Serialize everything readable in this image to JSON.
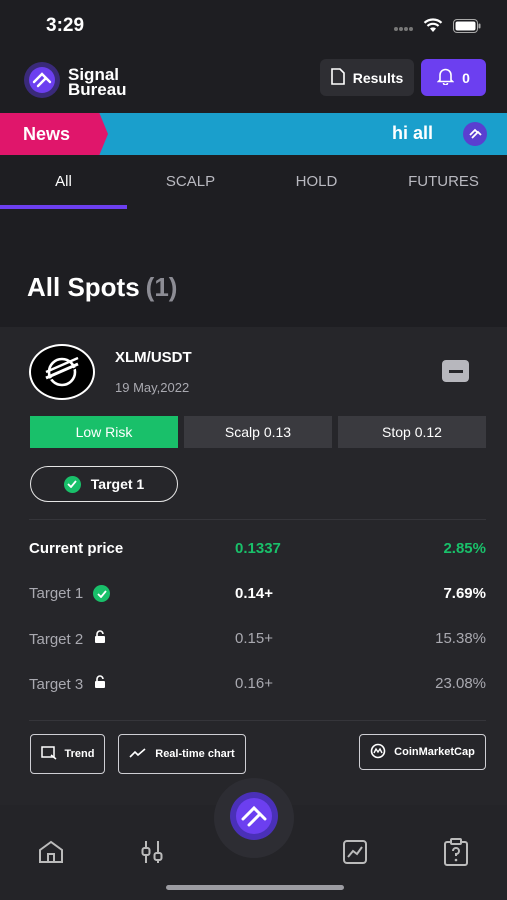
{
  "status": {
    "time": "3:29"
  },
  "header": {
    "logo_line1": "Signal",
    "logo_line2": "Bureau",
    "results_label": "Results",
    "notifications_count": "0"
  },
  "news": {
    "label": "News",
    "text": "hi all"
  },
  "tabs": [
    {
      "label": "All",
      "active": true
    },
    {
      "label": "SCALP"
    },
    {
      "label": "HOLD"
    },
    {
      "label": "FUTURES"
    }
  ],
  "section": {
    "title": "All Spots",
    "count": "(1)"
  },
  "signal": {
    "pair": "XLM/USDT",
    "date": "19 May,2022",
    "risk": "Low Risk",
    "scalp": "Scalp  0.13",
    "stop": "Stop  0.12",
    "target_badge": "Target 1",
    "rows": [
      {
        "label": "Current price",
        "value": "0.1337",
        "pct": "2.85%"
      },
      {
        "label": "Target 1",
        "value": "0.14+",
        "pct": "7.69%",
        "status": "reached"
      },
      {
        "label": "Target 2",
        "value": "0.15+",
        "pct": "15.38%",
        "status": "open"
      },
      {
        "label": "Target 3",
        "value": "0.16+",
        "pct": "23.08%",
        "status": "open"
      }
    ],
    "buttons": {
      "trend": "Trend",
      "realtime": "Real-time chart",
      "cmc": "CoinMarketCap"
    }
  },
  "colors": {
    "accent": "#6c3ff0",
    "success": "#19c06a",
    "news_label": "#e0166b",
    "news_bar": "#1a9fcc"
  },
  "icons": {
    "nav": [
      "home-icon",
      "sliders-icon",
      "app-logo-icon",
      "chart-icon",
      "clipboard-help-icon"
    ]
  }
}
